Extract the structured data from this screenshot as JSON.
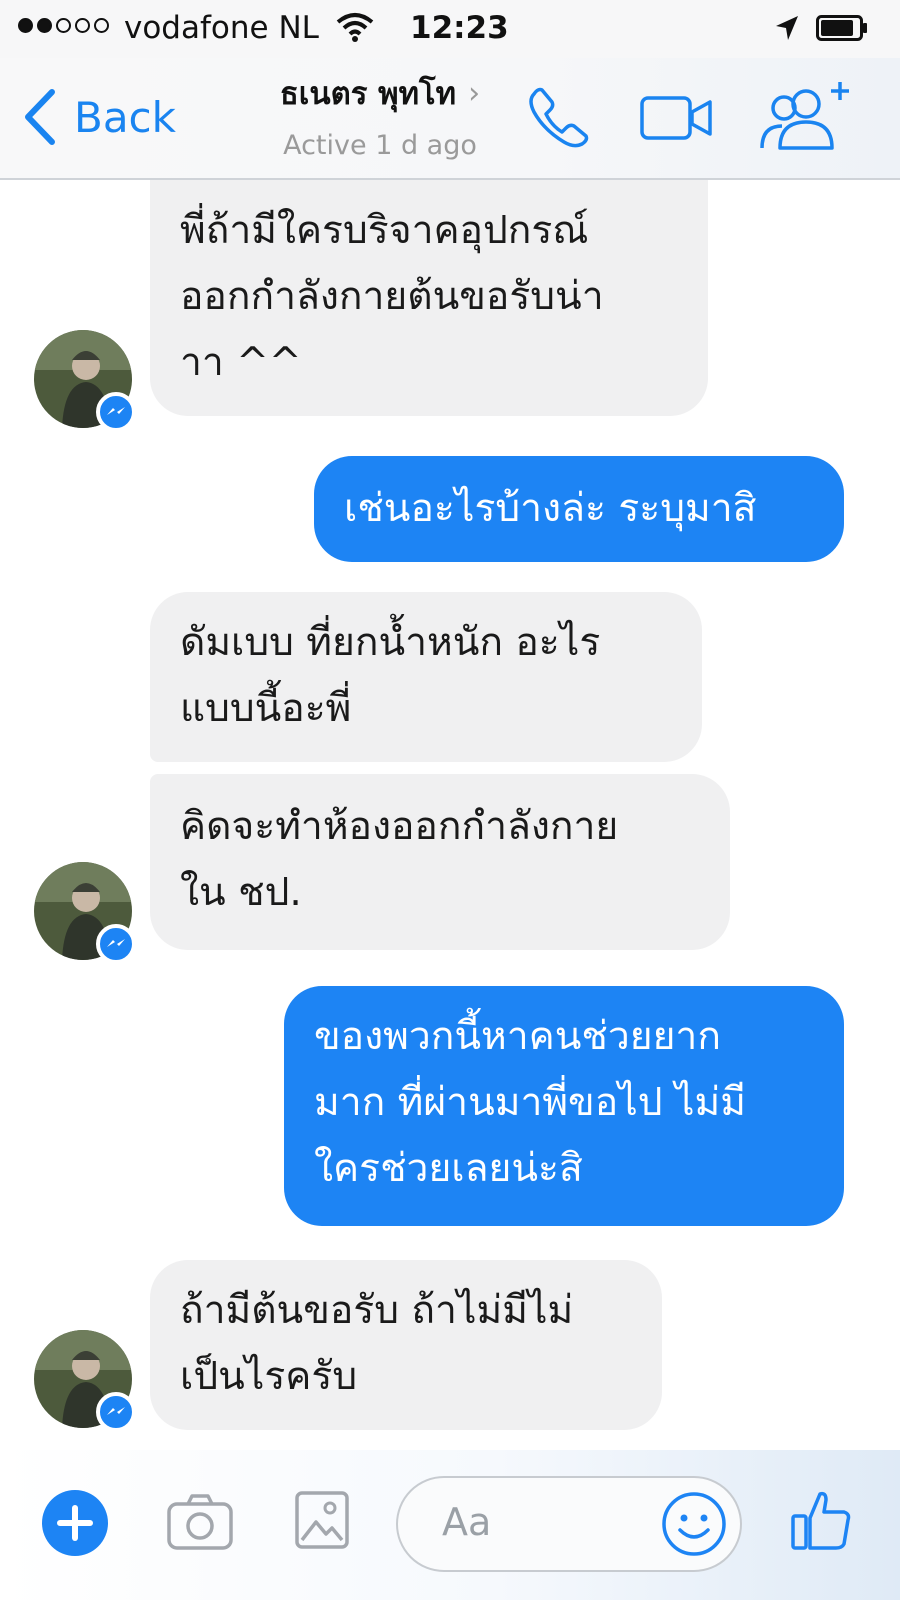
{
  "status_bar": {
    "carrier": "vodafone NL",
    "time": "12:23"
  },
  "header": {
    "back_label": "Back",
    "contact_name": "ธเนตร พุทโท",
    "contact_status": "Active 1 d ago"
  },
  "messages": [
    {
      "direction": "in",
      "text": "พี่ถ้ามีใครบริจาคอุปกรณ์\nออกกำลังกายต้นขอรับน่า\nาา ^^"
    },
    {
      "direction": "out",
      "text": "เช่นอะไรบ้างล่ะ ระบุมาสิ"
    },
    {
      "direction": "in",
      "text": "ดัมเบบ ที่ยกน้ำหนัก อะไร\nแบบนี้อะพี่"
    },
    {
      "direction": "in",
      "text": "คิดจะทำห้องออกกำลังกาย\nใน ชป."
    },
    {
      "direction": "out",
      "text": "ของพวกนี้หาคนช่วยยาก\nมาก ที่ผ่านมาพี่ขอไป ไม่มี\nใครช่วยเลยน่ะสิ"
    },
    {
      "direction": "in",
      "text": "ถ้ามีต้นขอรับ ถ้าไม่มีไม่\nเป็นไรครับ"
    }
  ],
  "composer": {
    "placeholder": "Aa"
  },
  "colors": {
    "accent": "#1d84f4",
    "incoming_bubble": "#f0f0f1"
  }
}
